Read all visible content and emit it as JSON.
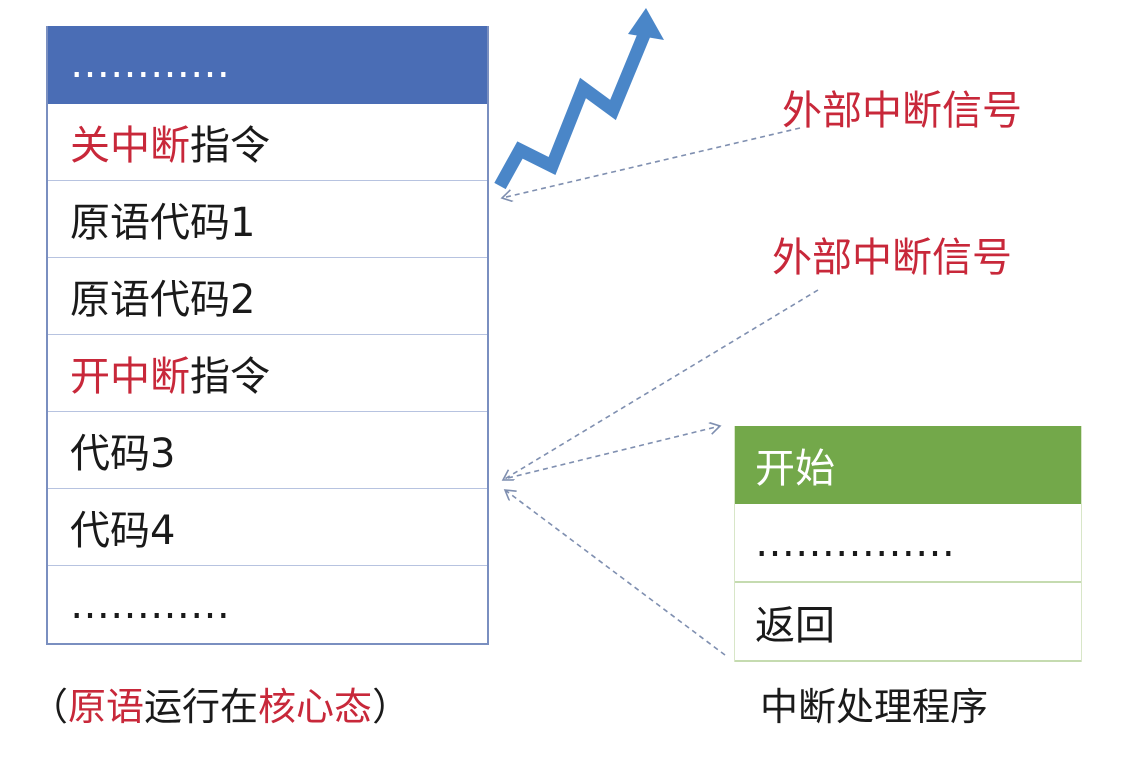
{
  "program_table": {
    "rows": [
      {
        "text": "…………",
        "kind": "header"
      },
      {
        "parts": [
          {
            "text": "关中断",
            "red": true
          },
          {
            "text": "指令",
            "red": false
          }
        ]
      },
      {
        "parts": [
          {
            "text": "原语代码1",
            "red": false
          }
        ]
      },
      {
        "parts": [
          {
            "text": "原语代码2",
            "red": false
          }
        ]
      },
      {
        "parts": [
          {
            "text": "开中断",
            "red": true
          },
          {
            "text": "指令",
            "red": false
          }
        ]
      },
      {
        "parts": [
          {
            "text": "代码3",
            "red": false
          }
        ]
      },
      {
        "parts": [
          {
            "text": "代码4",
            "red": false
          }
        ]
      },
      {
        "parts": [
          {
            "text": "…………",
            "red": false
          }
        ]
      }
    ],
    "caption_parts": [
      {
        "text": "（",
        "red": false
      },
      {
        "text": "原语",
        "red": true
      },
      {
        "text": "运行在",
        "red": false
      },
      {
        "text": "核心态",
        "red": true
      },
      {
        "text": "）",
        "red": false
      }
    ]
  },
  "signals": {
    "first": "外部中断信号",
    "second": "外部中断信号"
  },
  "handler": {
    "head": "开始",
    "body": "……………",
    "return": "返回",
    "caption": "中断处理程序"
  },
  "colors": {
    "table_header": "#4a6db5",
    "handler_header": "#73a84a",
    "accent_red": "#c8283a",
    "arrow_blue": "#4a86c8",
    "dashed_line": "#7f8fb0"
  }
}
